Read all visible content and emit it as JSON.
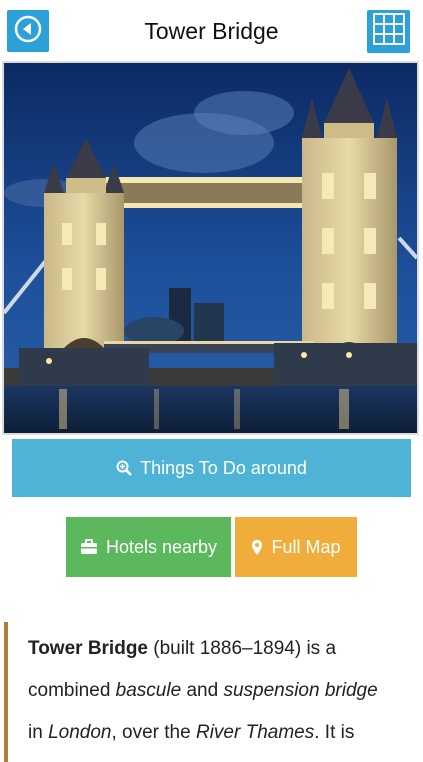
{
  "header": {
    "title": "Tower Bridge",
    "back_icon": "back-arrow-icon",
    "menu_icon": "grid-menu-icon"
  },
  "photo": {
    "subject": "Tower Bridge at dusk over the River Thames"
  },
  "buttons": {
    "things_to_do": "Things To Do around",
    "hotels": "Hotels nearby",
    "full_map": "Full Map"
  },
  "article": {
    "name": "Tower Bridge",
    "t1": " (built 1886–1894) is a combined ",
    "bascule": "bascule",
    "t2": " and ",
    "suspension": "suspension bridge",
    "t3": " in ",
    "london": "London",
    "t4": ", over the ",
    "river": "River Thames",
    "t5": ". It is"
  },
  "colors": {
    "accent_blue": "#2ba0d9",
    "todo_blue": "#4fb3d6",
    "hotels_green": "#5cb85c",
    "map_orange": "#f0ad3b",
    "quote_bar": "#b87a3a"
  }
}
